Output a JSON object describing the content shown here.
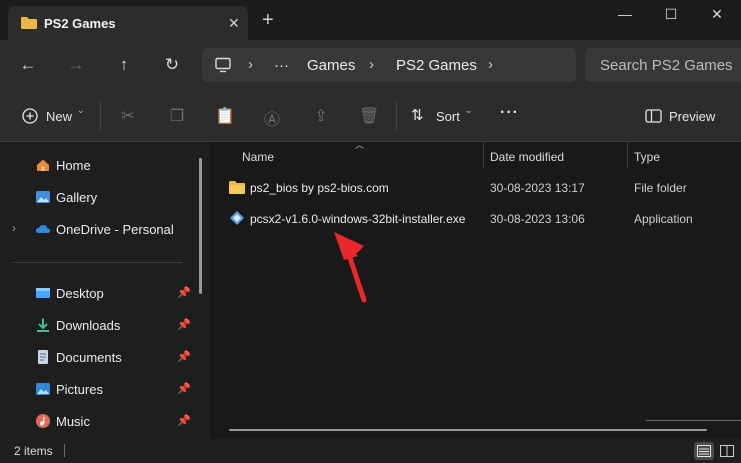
{
  "window": {
    "tab_title": "PS2 Games",
    "new_tab": "+",
    "minimize": "—",
    "maximize": "☐",
    "close": "✕"
  },
  "address": {
    "crumbs": [
      "Games",
      "PS2 Games"
    ],
    "more": "···",
    "search_placeholder": "Search PS2 Games"
  },
  "toolbar": {
    "new_label": "New",
    "sort_label": "Sort",
    "more": "···",
    "preview_label": "Preview"
  },
  "sidebar": {
    "items": [
      {
        "label": "Home",
        "icon": "home-icon"
      },
      {
        "label": "Gallery",
        "icon": "gallery-icon"
      },
      {
        "label": "OneDrive - Personal",
        "icon": "cloud-icon"
      },
      {
        "label": "Desktop",
        "icon": "desktop-icon"
      },
      {
        "label": "Downloads",
        "icon": "download-icon"
      },
      {
        "label": "Documents",
        "icon": "documents-icon"
      },
      {
        "label": "Pictures",
        "icon": "pictures-icon"
      },
      {
        "label": "Music",
        "icon": "music-icon"
      }
    ]
  },
  "columns": {
    "name": "Name",
    "date": "Date modified",
    "type": "Type"
  },
  "files": [
    {
      "name": "ps2_bios by ps2-bios.com",
      "date": "30-08-2023 13:17",
      "type": "File folder",
      "icon": "folder-icon"
    },
    {
      "name": "pcsx2-v1.6.0-windows-32bit-installer.exe",
      "date": "30-08-2023 13:06",
      "type": "Application",
      "icon": "installer-icon"
    }
  ],
  "status": {
    "count": "2 items"
  },
  "colors": {
    "folder": "#e8b74a",
    "annotation_arrow": "#e8282b",
    "accent": "#4aa3ff"
  }
}
